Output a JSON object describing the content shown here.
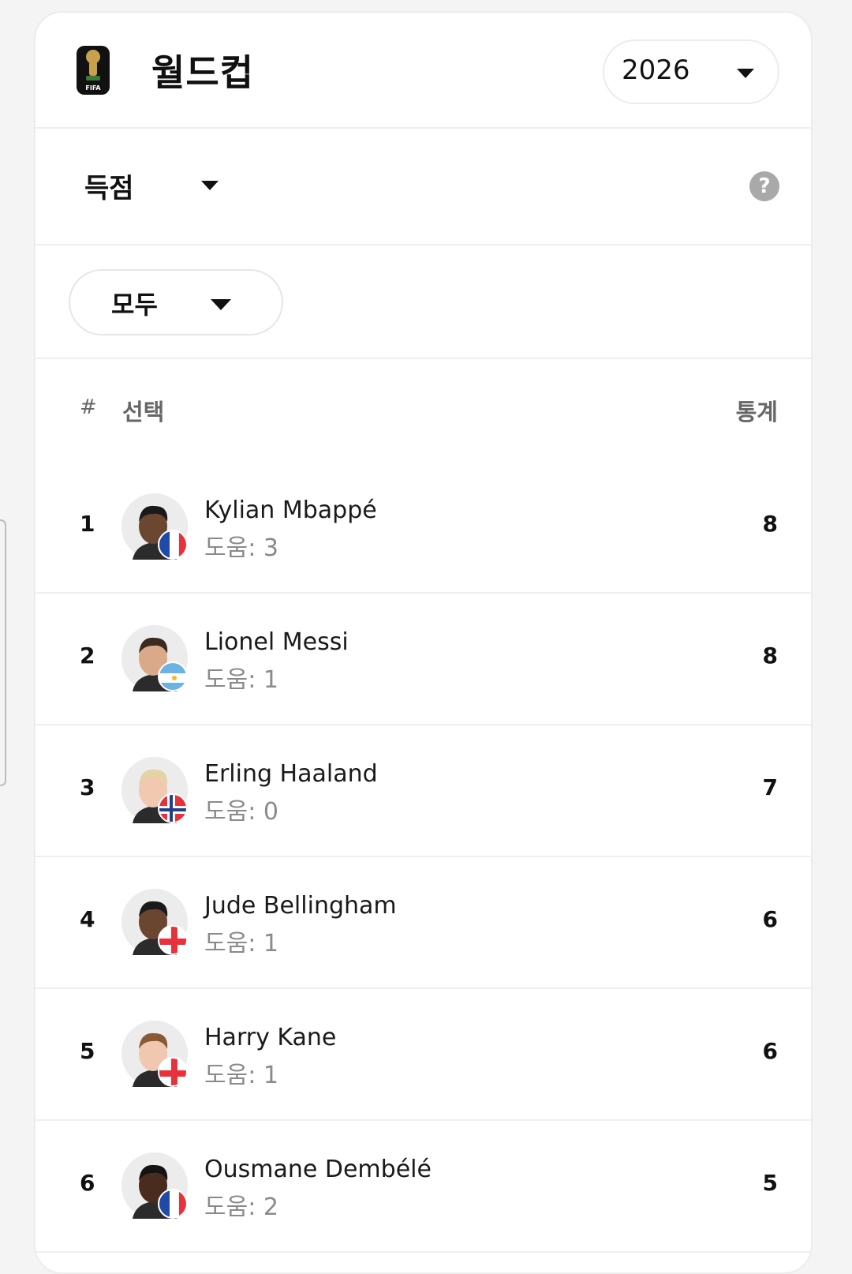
{
  "header": {
    "title": "월드컵",
    "year": "2026",
    "logo_text": "FIFA"
  },
  "stat_selector": {
    "label": "득점",
    "help_label": "?"
  },
  "filter": {
    "label": "모두"
  },
  "table": {
    "col_rank": "#",
    "col_player": "선택",
    "col_stat": "통계",
    "rows": [
      {
        "rank": "1",
        "name": "Kylian Mbappé",
        "assists": "도움: 3",
        "goals": "8",
        "flag": "france-flag-icon",
        "skin": "#6b4630",
        "hair": "#1a1a1a"
      },
      {
        "rank": "2",
        "name": "Lionel Messi",
        "assists": "도움: 1",
        "goals": "8",
        "flag": "argentina-flag-icon",
        "skin": "#d9a98a",
        "hair": "#3b2a20"
      },
      {
        "rank": "3",
        "name": "Erling Haaland",
        "assists": "도움: 0",
        "goals": "7",
        "flag": "norway-flag-icon",
        "skin": "#f1c9b1",
        "hair": "#e4d3a5"
      },
      {
        "rank": "4",
        "name": "Jude Bellingham",
        "assists": "도움: 1",
        "goals": "6",
        "flag": "england-flag-icon",
        "skin": "#6a4530",
        "hair": "#1a1a1a"
      },
      {
        "rank": "5",
        "name": "Harry Kane",
        "assists": "도움: 1",
        "goals": "6",
        "flag": "england-flag-icon",
        "skin": "#f0c8b0",
        "hair": "#8a5a35"
      },
      {
        "rank": "6",
        "name": "Ousmane Dembélé",
        "assists": "도움: 2",
        "goals": "5",
        "flag": "france-flag-icon",
        "skin": "#4a2c1e",
        "hair": "#141414"
      }
    ]
  },
  "colors": {
    "france_blue": "#1f4aa8",
    "france_red": "#e8323b",
    "argentina_blue": "#6cb2e3",
    "norway_red": "#e8323b",
    "norway_blue": "#1f3f8a",
    "england_red": "#e8323b"
  }
}
